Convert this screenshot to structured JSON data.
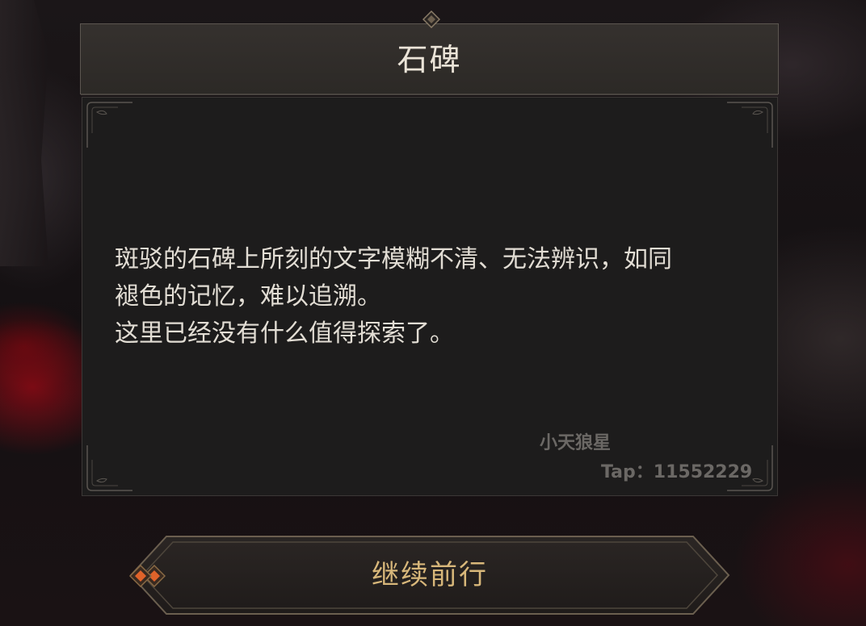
{
  "dialog": {
    "title": "石碑",
    "lines": [
      "斑驳的石碑上所刻的文字模糊不清、无法辨识，如同",
      "褪色的记忆，难以追溯。",
      "这里已经没有什么值得探索了。"
    ],
    "watermark_author": "小天狼星",
    "watermark_tap": "Tap：11552229"
  },
  "continue_button": {
    "label": "继续前行"
  },
  "colors": {
    "title_text": "#ebe4d8",
    "body_text": "#e2ddd4",
    "button_text": "#d8b77a",
    "button_gem": "#e0632a",
    "panel_bg": "#1d1c1c"
  },
  "icons": {
    "title_ornament": "diamond-gem-icon",
    "button_left": "diamond-gem-icon",
    "button_right": "diamond-gem-icon"
  }
}
